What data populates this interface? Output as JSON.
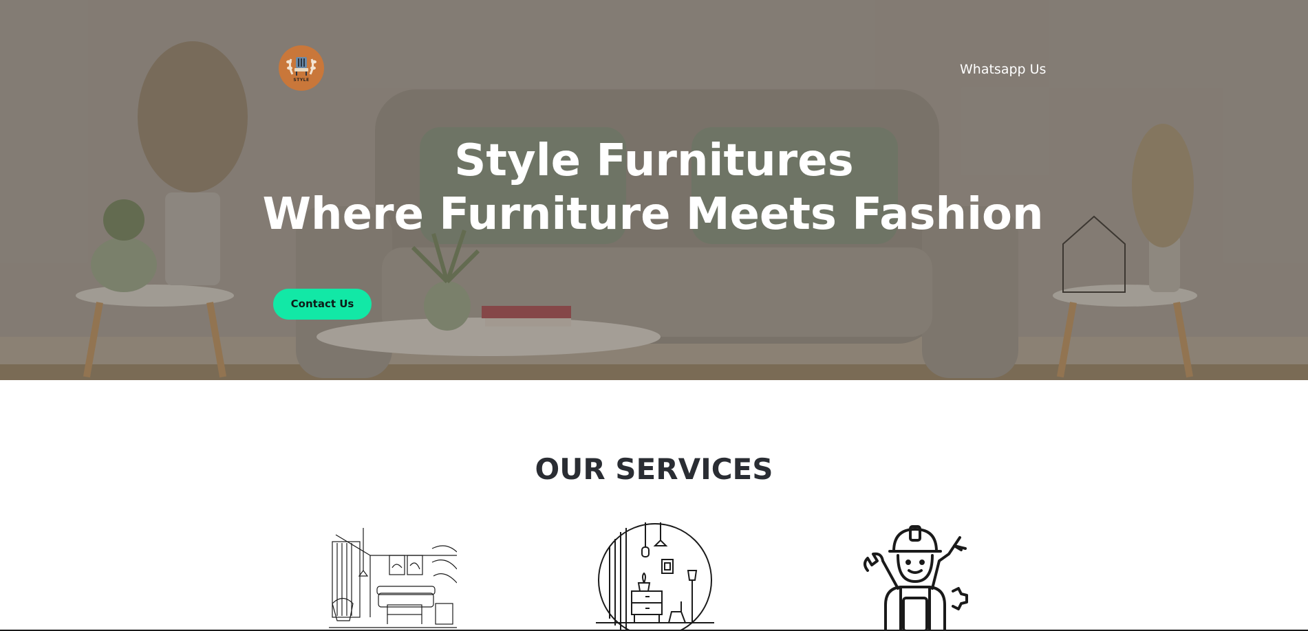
{
  "header": {
    "logo_alt": "Style Furnitures logo",
    "logo_text": "STYLE",
    "nav": [
      {
        "label": "Whatsapp Us"
      }
    ]
  },
  "hero": {
    "title_line1": "Style Furnitures",
    "title_line2": "Where Furniture Meets Fashion",
    "cta_label": "Contact Us",
    "colors": {
      "cta_bg": "#12e8a6",
      "logo_bg": "#c9773a",
      "overlay": "#8a8279"
    }
  },
  "services": {
    "title": "OUR SERVICES",
    "items": [
      {
        "icon": "living-room-sketch-icon"
      },
      {
        "icon": "interior-circle-icon"
      },
      {
        "icon": "worker-with-tools-icon"
      }
    ]
  }
}
